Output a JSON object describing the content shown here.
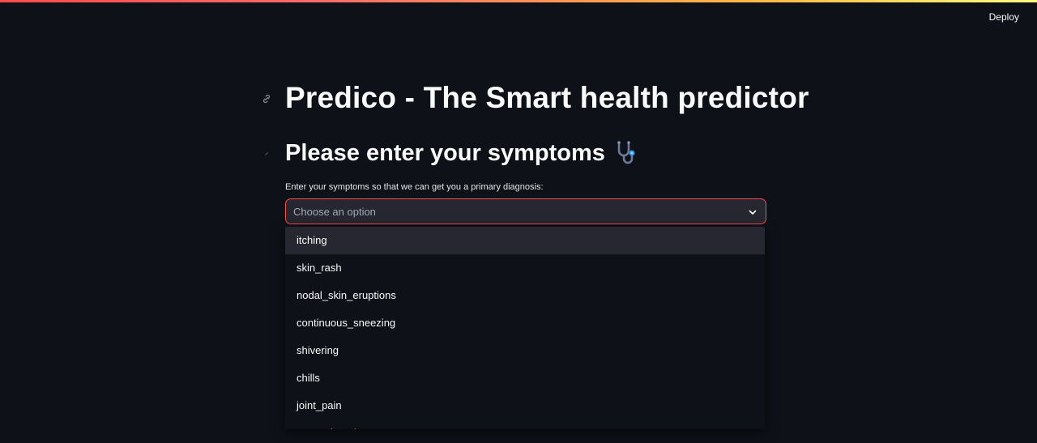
{
  "header": {
    "deploy_label": "Deploy"
  },
  "main": {
    "title": "Predico - The Smart health predictor",
    "section_heading": "Please enter your symptoms",
    "section_icon": "stethoscope-icon",
    "field_label": "Enter your symptoms so that we can get you a primary diagnosis:",
    "select": {
      "placeholder": "Choose an option",
      "options": [
        "itching",
        "skin_rash",
        "nodal_skin_eruptions",
        "continuous_sneezing",
        "shivering",
        "chills",
        "joint_pain",
        "stomach_pain"
      ],
      "highlighted_index": 0
    }
  },
  "colors": {
    "background": "#0e1117",
    "accent": "#ff4b4b",
    "input_bg": "#262730",
    "text": "#fafafa",
    "placeholder": "#a3a8b8"
  }
}
